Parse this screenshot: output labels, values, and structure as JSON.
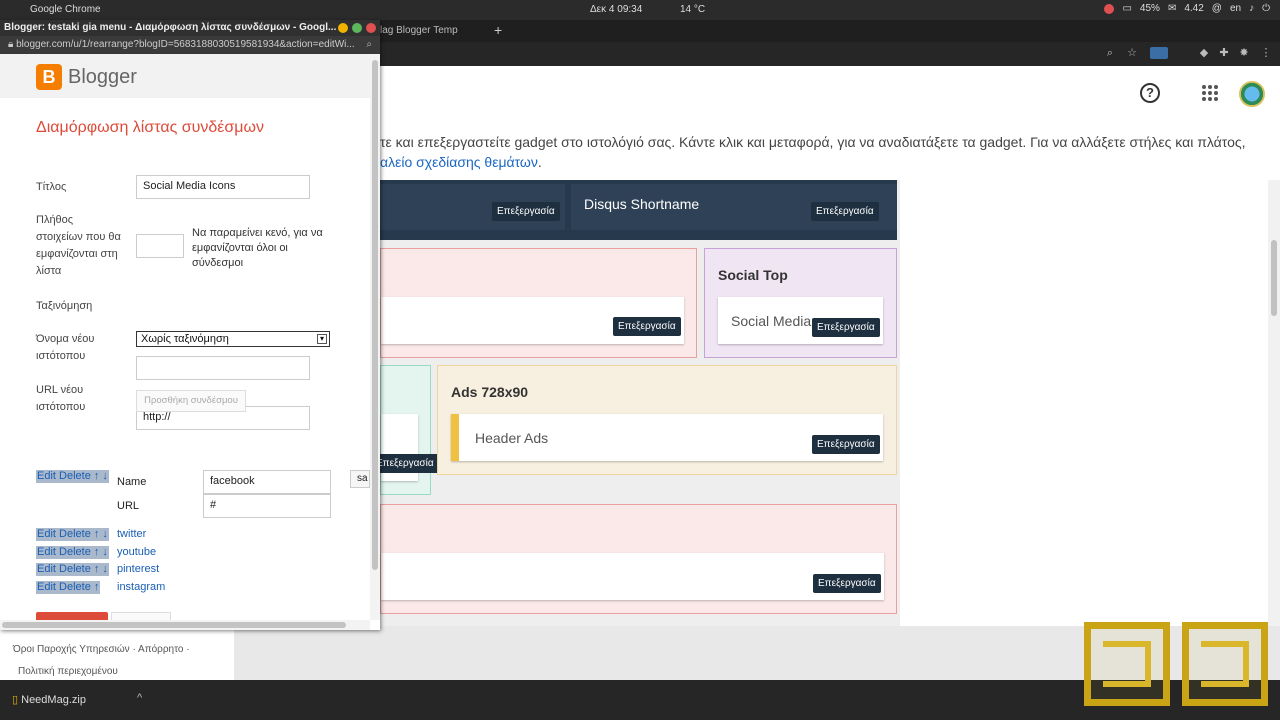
{
  "os": {
    "app_name": "Google Chrome",
    "clock": "Δεκ 4  09:34",
    "temp": "14 °C",
    "battery": "45%",
    "messages": "4.42",
    "lang": "en"
  },
  "chrome": {
    "tab_title": "lag Blogger Temp",
    "new_tab": "+"
  },
  "page": {
    "intro_line1": "τε και επεξεργαστείτε gadget στο ιστολόγιό σας. Κάντε κλικ και μεταφορά, για να αναδιατάξετε τα gadget. Για να αλλάξετε στήλες και πλάτος,",
    "intro_link": "αλείο σχεδίασης θεμάτων",
    "intro_end": ".",
    "edit_label": "Επεξεργασία",
    "sections": {
      "disqus": "Disqus Shortname",
      "social_top_title": "Social Top",
      "social_media_gadget": "Social Media",
      "ads_title": "Ads 728x90",
      "header_ads_gadget": "Header Ads"
    }
  },
  "popup": {
    "window_title": "Blogger: testaki gia menu - Διαμόρφωση λίστας συνδέσμων - Googl...",
    "url": "blogger.com/u/1/rearrange?blogID=5683188030519581934&action=editWi...",
    "logo_text": "Blogger",
    "heading": "Διαμόρφωση λίστας συνδέσμων",
    "form": {
      "title_label": "Τίτλος",
      "title_value": "Social Media Icons",
      "count_label_lines": [
        "Πλήθος",
        "στοιχείων που θα",
        "εμφανίζονται στη",
        "λίστα"
      ],
      "count_value": "",
      "count_hint": "Να παραμείνει κενό, για να εμφανίζονται όλοι οι σύνδεσμοι",
      "sort_label": "Ταξινόμηση",
      "sort_value": "Χωρίς ταξινόμηση",
      "new_site_name_label_lines": [
        "Όνομα νέου",
        "ιστότοπου"
      ],
      "new_site_name_value": "",
      "new_site_url_label_lines": [
        "URL νέου",
        "ιστότοπου"
      ],
      "new_site_url_value": "http://",
      "add_link_button": "Προσθήκη συνδέσμου"
    },
    "edit_row": {
      "actions": "Edit Delete ↑ ↓",
      "name_label": "Name",
      "name_value": "facebook",
      "url_label": "URL",
      "url_value": "#",
      "save_partial": "sa"
    },
    "links": [
      {
        "actions": "Edit Delete ↑ ↓",
        "label": "twitter"
      },
      {
        "actions": "Edit Delete ↑ ↓",
        "label": "youtube"
      },
      {
        "actions": "Edit Delete ↑ ↓",
        "label": "pinterest"
      },
      {
        "actions": "Edit Delete ↑",
        "label": "instagram"
      }
    ]
  },
  "footer": {
    "line1": "Όροι Παροχής Υπηρεσιών  ·  Απόρρητο  ·",
    "line2": "Πολιτική περιεχομένου"
  },
  "shelf": {
    "download_name": "NeedMag.zip",
    "chevron": "^"
  },
  "colors": {
    "accent_red": "#dd4b39",
    "blogger_orange": "#f57d00",
    "dark_header": "#27394d",
    "link_blue": "#1a66c4"
  }
}
